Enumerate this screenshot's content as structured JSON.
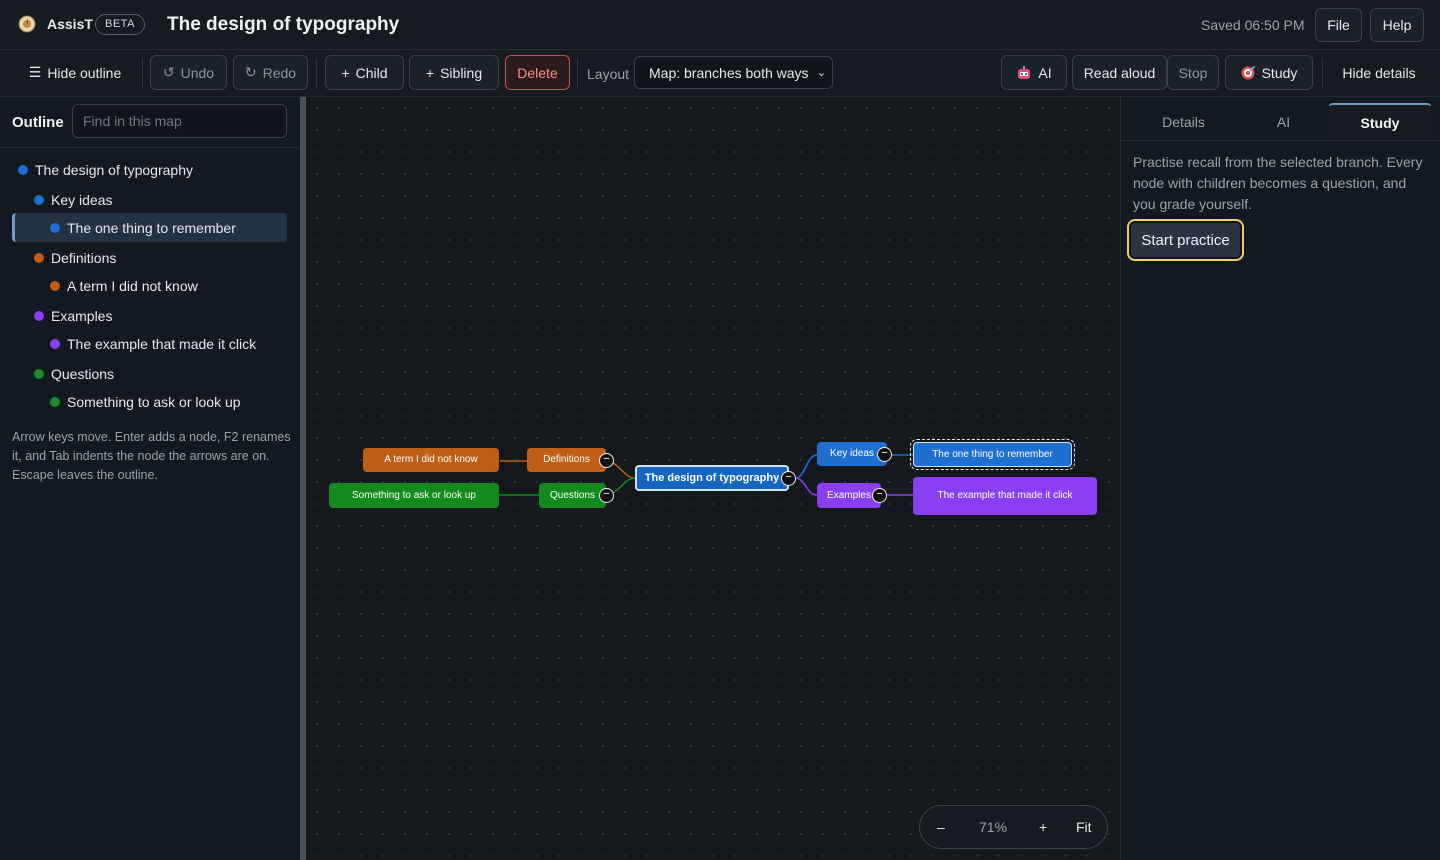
{
  "app": {
    "name": "AssisT",
    "badge": "BETA",
    "doc_title": "The design of typography",
    "saved_status": "Saved 06:50 PM",
    "file_label": "File",
    "help_label": "Help"
  },
  "toolbar": {
    "hide_outline": "Hide outline",
    "undo": "Undo",
    "redo": "Redo",
    "child": "Child",
    "sibling": "Sibling",
    "delete": "Delete",
    "layout_label": "Layout",
    "layout_value": "Map: branches both ways",
    "ai": "AI",
    "read_aloud": "Read aloud",
    "stop": "Stop",
    "study": "Study",
    "hide_details": "Hide details"
  },
  "outline": {
    "title": "Outline",
    "search_placeholder": "Find in this map",
    "items": [
      {
        "label": "The design of typography",
        "color": "#1f6fd1",
        "level": 0,
        "selected": false
      },
      {
        "label": "Key ideas",
        "color": "#1f6fd1",
        "level": 1,
        "selected": false
      },
      {
        "label": "The one thing to remember",
        "color": "#1f6fd1",
        "level": 2,
        "selected": true
      },
      {
        "label": "Definitions",
        "color": "#c05e15",
        "level": 1,
        "selected": false
      },
      {
        "label": "A term I did not know",
        "color": "#c05e15",
        "level": 2,
        "selected": false
      },
      {
        "label": "Examples",
        "color": "#8a3ff0",
        "level": 1,
        "selected": false
      },
      {
        "label": "The example that made it click",
        "color": "#8a3ff0",
        "level": 2,
        "selected": false
      },
      {
        "label": "Questions",
        "color": "#1f8a2a",
        "level": 1,
        "selected": false
      },
      {
        "label": "Something to ask or look up",
        "color": "#1f8a2a",
        "level": 2,
        "selected": false
      }
    ],
    "help": "Arrow keys move. Enter adds a node, F2 renames it, and Tab indents the node the arrows are on. Escape leaves the outline."
  },
  "map": {
    "root": "The design of typography",
    "key_ideas": "Key ideas",
    "one_thing": "The one thing to remember",
    "examples": "Examples",
    "example_click": "The example that made it click",
    "definitions": "Definitions",
    "term": "A term I did not know",
    "questions": "Questions",
    "ask": "Something to ask or look up",
    "colors": {
      "blue": "#1f6fd1",
      "orange": "#c05e15",
      "purple": "#8a3ff0",
      "green": "#138a1e"
    }
  },
  "zoom": {
    "minus": "–",
    "level": "71%",
    "plus": "+",
    "fit": "Fit"
  },
  "details": {
    "tabs": [
      "Details",
      "AI",
      "Study"
    ],
    "active_tab": "Study",
    "study_description": "Practise recall from the selected branch. Every node with children becomes a question, and you grade yourself.",
    "start_button": "Start practice"
  }
}
